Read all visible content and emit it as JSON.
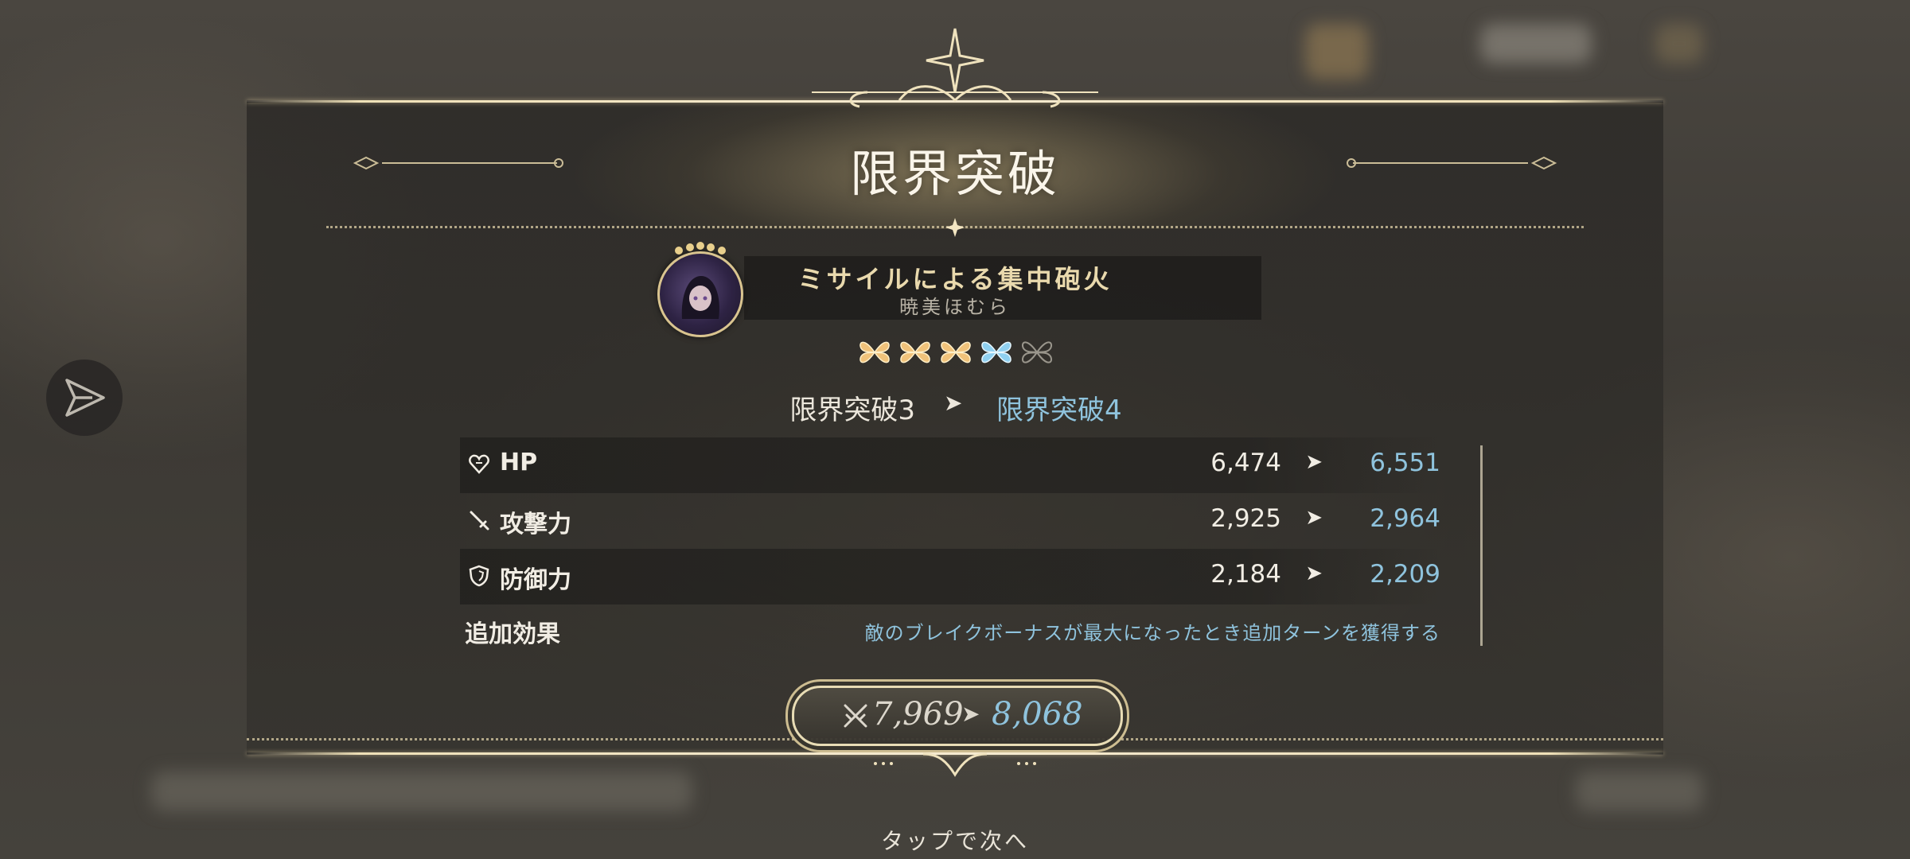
{
  "title": "限界突破",
  "skill": {
    "name": "ミサイルによる集中砲火",
    "character": "暁美ほむら"
  },
  "gems": {
    "total": 5,
    "gold": 3,
    "blue": 1,
    "empty": 1
  },
  "limit_break": {
    "from": "限界突破3",
    "arrow": "➤",
    "to": "限界突破4"
  },
  "stats": [
    {
      "icon": "heart-icon",
      "label": "HP",
      "old": "6,474",
      "new": "6,551"
    },
    {
      "icon": "sword-icon",
      "label": "攻撃力",
      "old": "2,925",
      "new": "2,964"
    },
    {
      "icon": "shield-icon",
      "label": "防御力",
      "old": "2,184",
      "new": "2,209"
    }
  ],
  "extra_effect": {
    "label": "追加効果",
    "text": "敵のブレイクボーナスが最大になったとき追加ターンを獲得する"
  },
  "power": {
    "old": "7,969",
    "arrow": "➤",
    "new": "8,068"
  },
  "tap_next": "タップで次へ",
  "colors": {
    "accent_blue": "#8fc3dd",
    "gold": "#e8dcb5",
    "text": "#f1ede4"
  }
}
